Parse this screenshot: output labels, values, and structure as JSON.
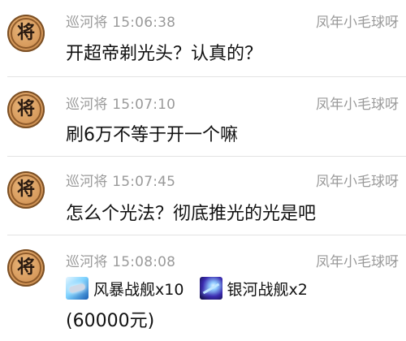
{
  "avatar_char": "将",
  "messages": [
    {
      "sender": "巡河将",
      "time": "15:06:38",
      "receiver": "凤年小毛球呀",
      "text": "开超帝剃光头？认真的？"
    },
    {
      "sender": "巡河将",
      "time": "15:07:10",
      "receiver": "凤年小毛球呀",
      "text": "刷6万不等于开一个嘛"
    },
    {
      "sender": "巡河将",
      "time": "15:07:45",
      "receiver": "凤年小毛球呀",
      "text": "怎么个光法？彻底推光的光是吧"
    },
    {
      "sender": "巡河将",
      "time": "15:08:08",
      "receiver": "凤年小毛球呀",
      "gifts": [
        {
          "icon": "storm-battleship-icon",
          "label": "风暴战舰x10"
        },
        {
          "icon": "galaxy-battleship-icon",
          "label": "银河战舰x2"
        }
      ],
      "price": "(60000元)"
    }
  ]
}
